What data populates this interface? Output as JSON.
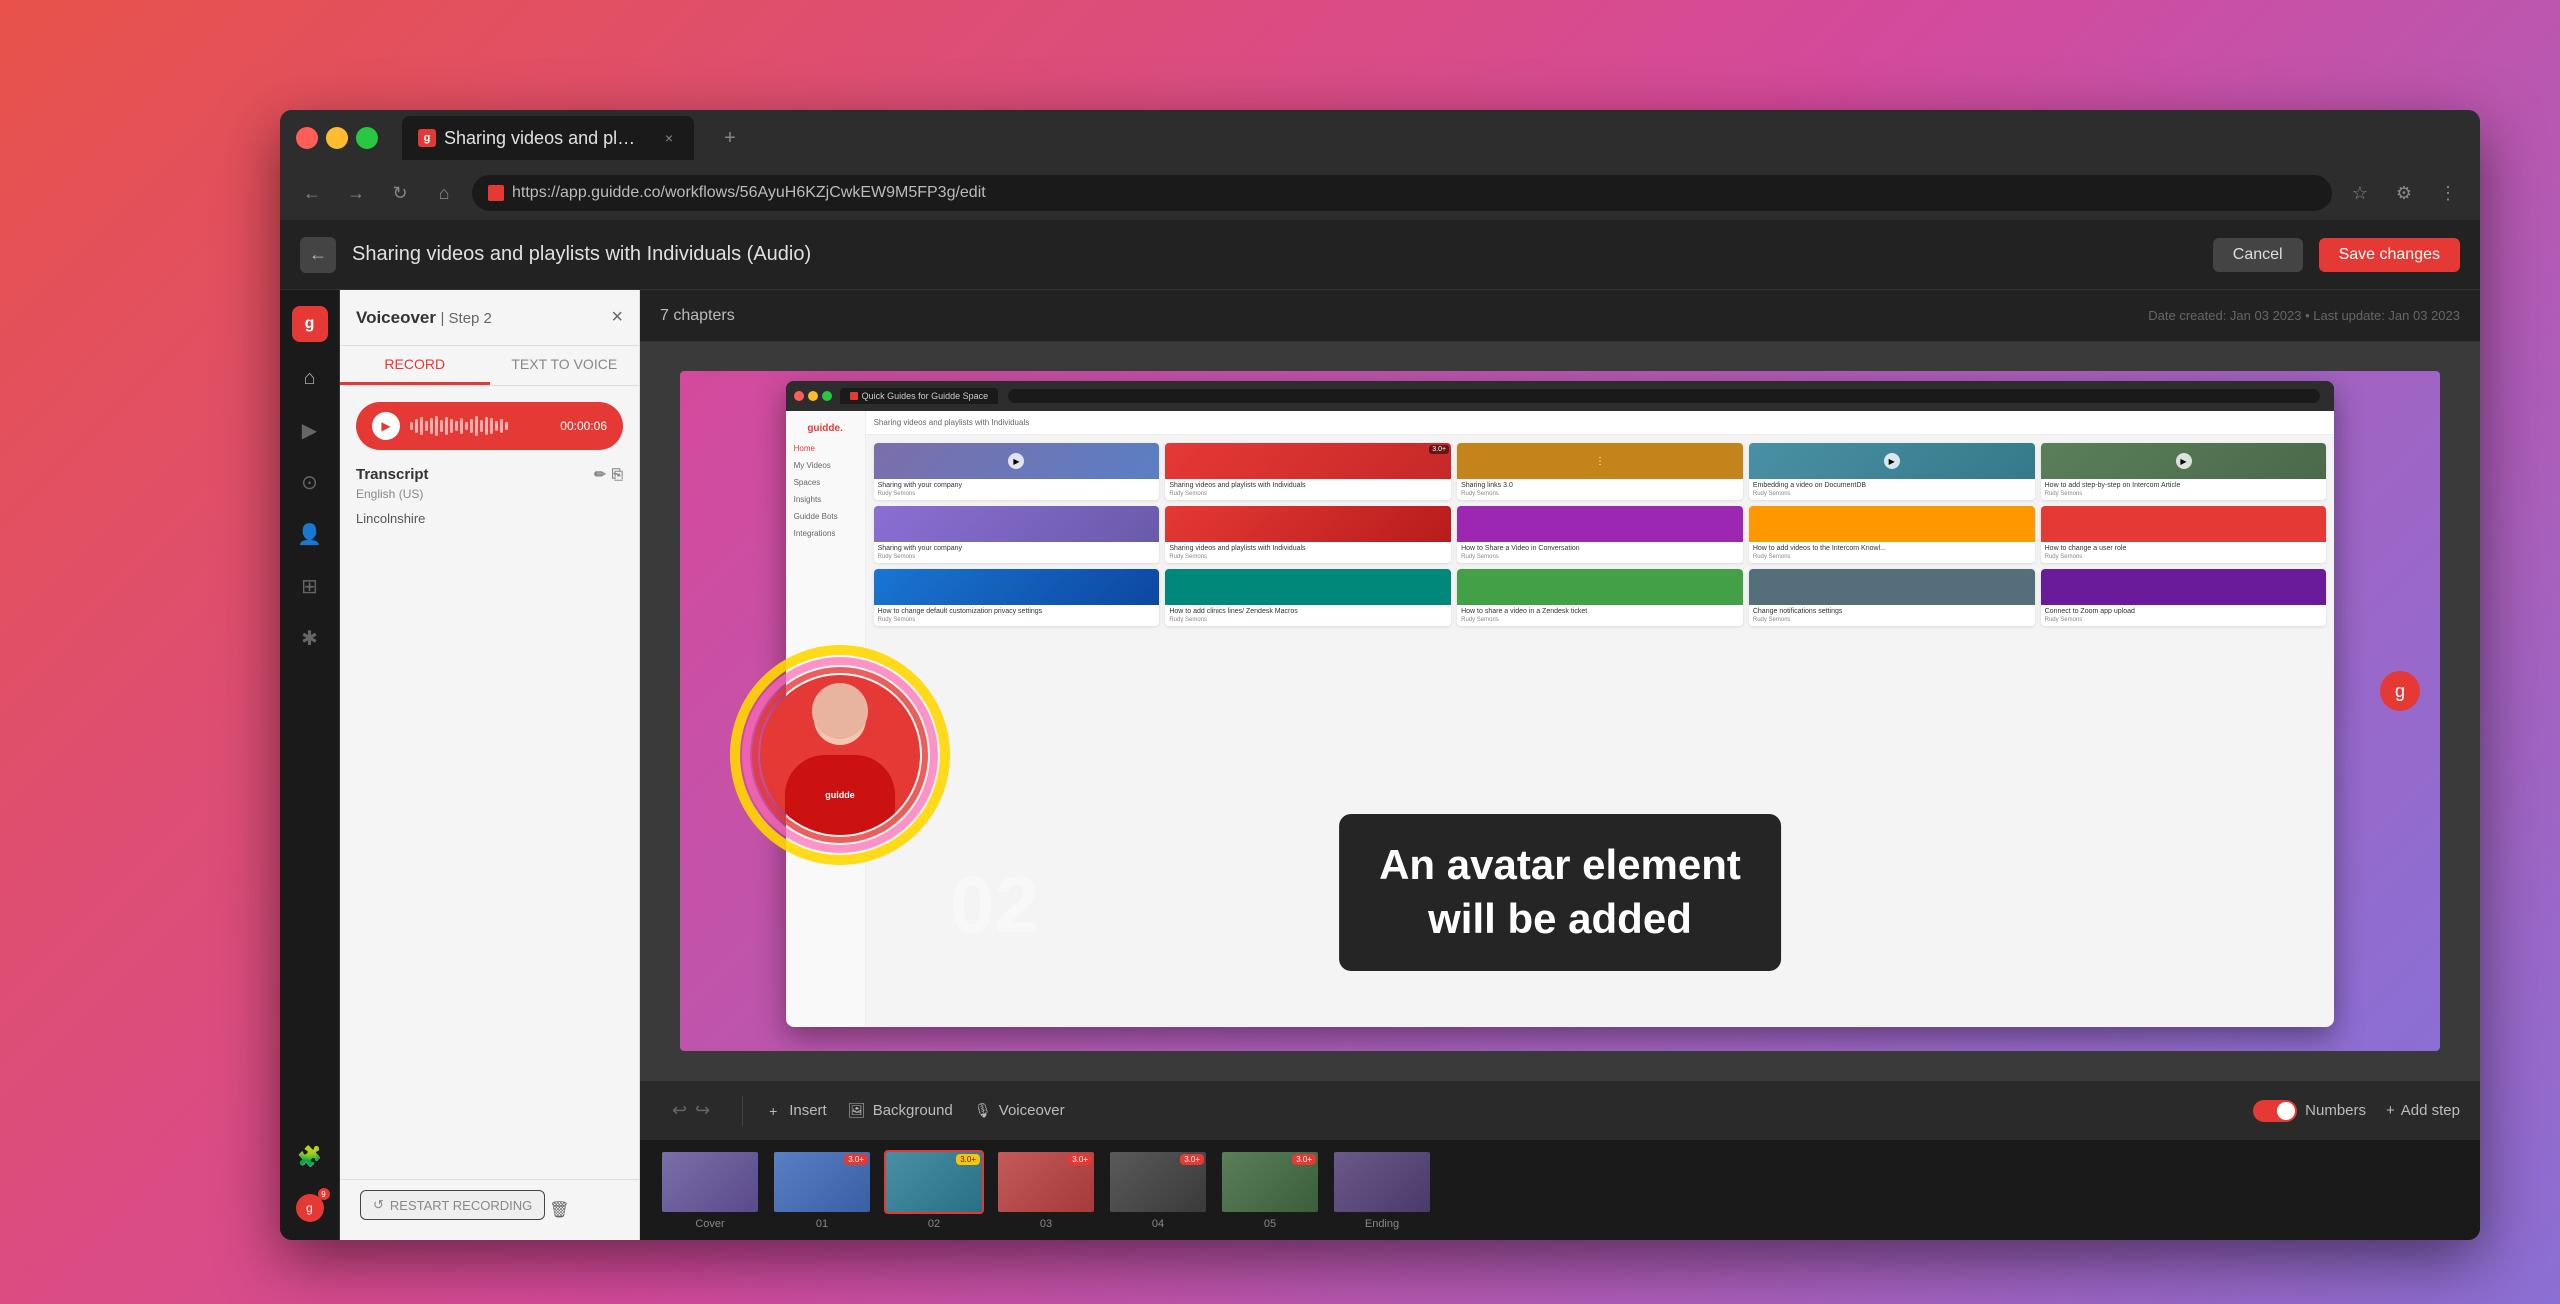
{
  "browser": {
    "tab_title": "Sharing videos and playlists with",
    "address": "https://app.guidde.co/workflows/56AyuH6KZjCwkEW9M5FP3g/edit",
    "tab_close": "×",
    "tab_new": "+"
  },
  "app_header": {
    "title": "Sharing videos and playlists with Individuals (Audio)",
    "cancel_label": "Cancel",
    "save_label": "Save changes"
  },
  "chapters": {
    "count": "7 chapters"
  },
  "date_info": "Date created: Jan 03 2023 • Last update: Jan 03 2023",
  "panel": {
    "title": "Voiceover",
    "step": "| Step 2",
    "tabs": [
      "RECORD",
      "TEXT TO VOICE"
    ],
    "active_tab": "RECORD",
    "audio_time": "00:00:06",
    "transcript_label": "Transcript",
    "transcript_lang": "English (US)",
    "transcript_text": "Lincolnshire"
  },
  "inner_browser": {
    "tab_text": "Quick Guides for Guidde Space",
    "sidebar_items": [
      "Home",
      "My Videos",
      "Spaces",
      "Insights",
      "Guidde Bots",
      "Integrations"
    ]
  },
  "caption": {
    "text": "An avatar element\nwill be added"
  },
  "toolbar": {
    "undo_label": "↩",
    "redo_label": "↪",
    "insert_label": "Insert",
    "background_label": "Background",
    "voiceover_label": "Voiceover",
    "numbers_label": "Numbers",
    "add_step_label": "Add step"
  },
  "filmstrip": {
    "items": [
      {
        "label": "Cover",
        "color": "#7c6eaa",
        "badge": "",
        "active": false
      },
      {
        "label": "01",
        "color": "#5a7fc4",
        "badge": "3.0+",
        "active": false
      },
      {
        "label": "02",
        "color": "#4a90a4",
        "badge": "3.0+",
        "active": true
      },
      {
        "label": "03",
        "color": "#c45a5a",
        "badge": "3.0+",
        "active": false
      },
      {
        "label": "04",
        "color": "#5a5a5a",
        "badge": "3.0+",
        "active": false
      },
      {
        "label": "05",
        "color": "#5a7f5a",
        "badge": "3.0+",
        "active": false
      },
      {
        "label": "Ending",
        "color": "#6a5a8a",
        "badge": "",
        "active": false
      }
    ]
  },
  "panel_footer": {
    "restart_label": "RESTART RECORDING",
    "delete_icon": "🗑"
  },
  "colors": {
    "accent": "#e53935",
    "active_tab_border": "#e53935",
    "toggle_active": "#e53935"
  }
}
